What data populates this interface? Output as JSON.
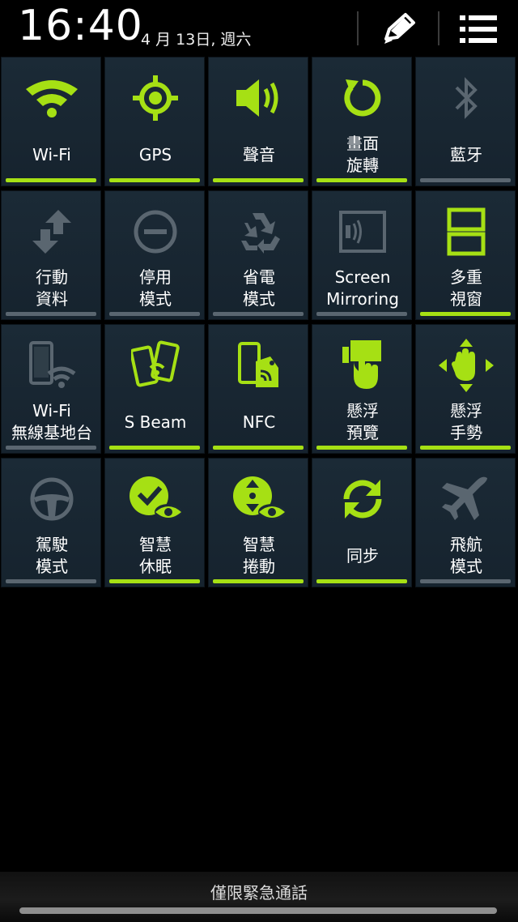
{
  "status": {
    "time": "16:40",
    "date": "4 月 13日, 週六"
  },
  "header": {
    "edit_icon": "pencil-icon",
    "menu_icon": "list-icon"
  },
  "accent_color": "#a6e014",
  "inactive_color": "#5a6670",
  "tiles": [
    {
      "id": "wifi",
      "label": "Wi-Fi",
      "icon": "wifi-icon",
      "on": true
    },
    {
      "id": "gps",
      "label": "GPS",
      "icon": "gps-icon",
      "on": true
    },
    {
      "id": "sound",
      "label": "聲音",
      "icon": "speaker-icon",
      "on": true
    },
    {
      "id": "rotate",
      "label": "畫面\n旋轉",
      "icon": "rotate-icon",
      "on": true
    },
    {
      "id": "bluetooth",
      "label": "藍牙",
      "icon": "bluetooth-icon",
      "on": false
    },
    {
      "id": "mobile-data",
      "label": "行動\n資料",
      "icon": "data-arrows-icon",
      "on": false
    },
    {
      "id": "blocking",
      "label": "停用\n模式",
      "icon": "blocking-icon",
      "on": false
    },
    {
      "id": "power-saving",
      "label": "省電\n模式",
      "icon": "recycle-icon",
      "on": false
    },
    {
      "id": "screen-mirroring",
      "label": "Screen\nMirroring",
      "icon": "screen-mirroring-icon",
      "on": false
    },
    {
      "id": "multi-window",
      "label": "多重\n視窗",
      "icon": "multi-window-icon",
      "on": true
    },
    {
      "id": "wifi-hotspot",
      "label": "Wi-Fi\n無線基地台",
      "icon": "hotspot-icon",
      "on": false
    },
    {
      "id": "s-beam",
      "label": "S Beam",
      "icon": "s-beam-icon",
      "on": true
    },
    {
      "id": "nfc",
      "label": "NFC",
      "icon": "nfc-icon",
      "on": true
    },
    {
      "id": "air-view",
      "label": "懸浮\n預覽",
      "icon": "air-view-icon",
      "on": true
    },
    {
      "id": "air-gesture",
      "label": "懸浮\n手勢",
      "icon": "air-gesture-icon",
      "on": true
    },
    {
      "id": "driving-mode",
      "label": "駕駛\n模式",
      "icon": "steering-wheel-icon",
      "on": false
    },
    {
      "id": "smart-stay",
      "label": "智慧\n休眠",
      "icon": "smart-stay-icon",
      "on": true
    },
    {
      "id": "smart-scroll",
      "label": "智慧\n捲動",
      "icon": "smart-scroll-icon",
      "on": true
    },
    {
      "id": "sync",
      "label": "同步",
      "icon": "sync-icon",
      "on": true
    },
    {
      "id": "flight-mode",
      "label": "飛航\n模式",
      "icon": "airplane-icon",
      "on": false
    }
  ],
  "footer": {
    "emergency_label": "僅限緊急通話"
  }
}
